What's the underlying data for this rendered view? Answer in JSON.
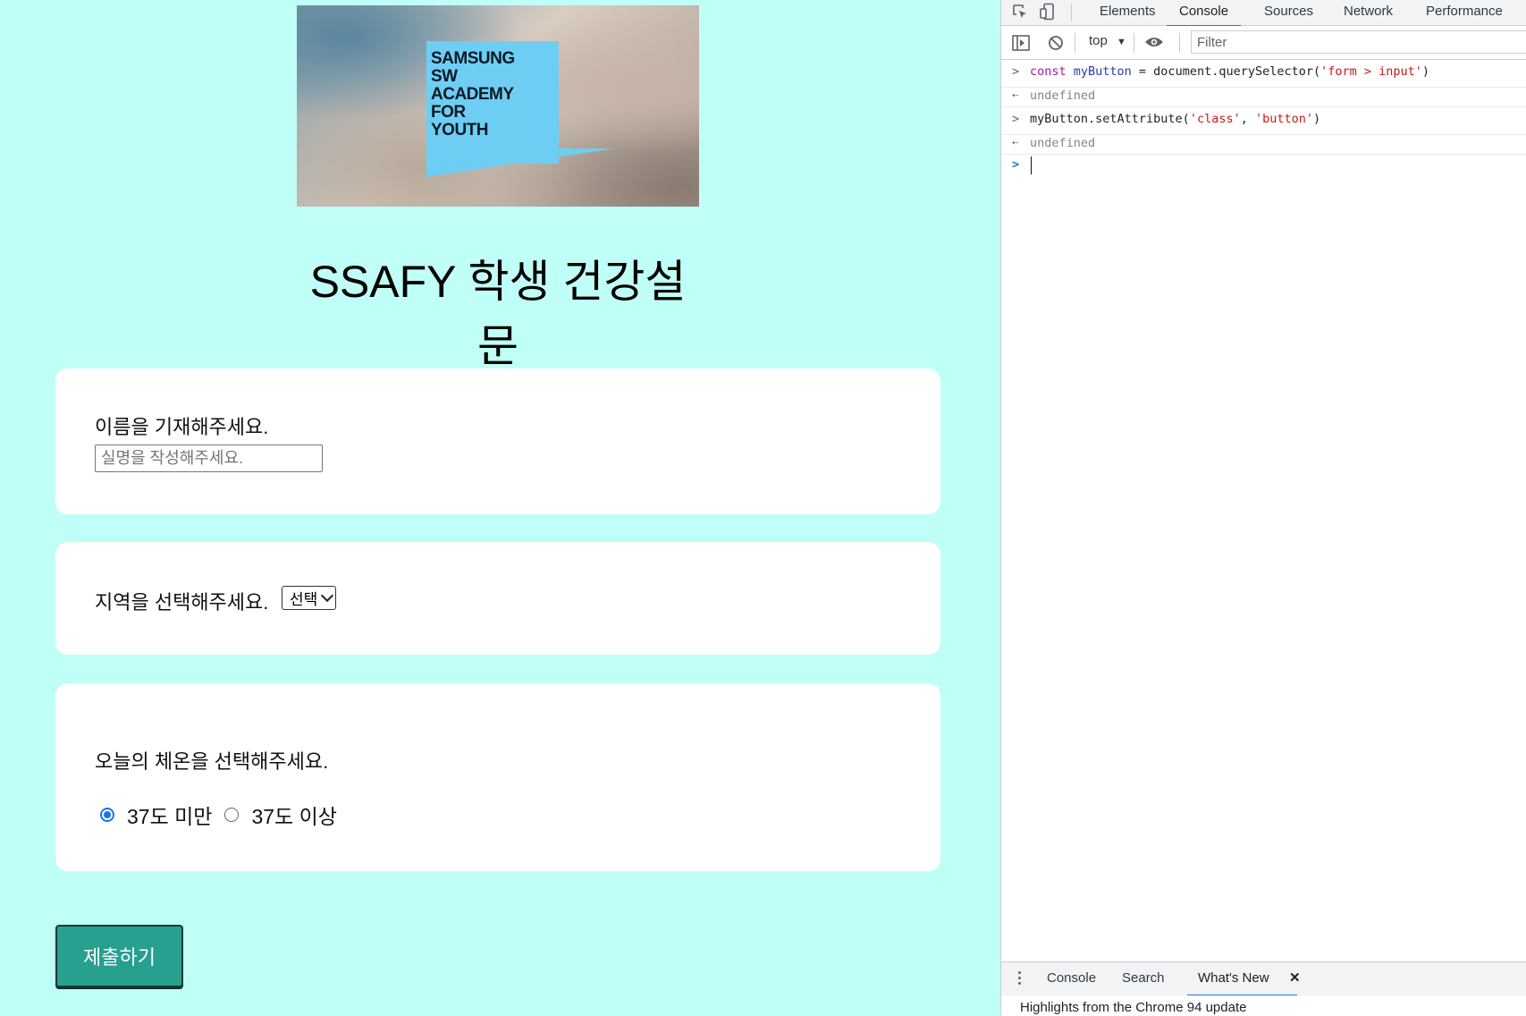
{
  "banner": {
    "logo_lines": [
      "SAMSUNG",
      "SW",
      "ACADEMY",
      "FOR",
      "YOUTH"
    ]
  },
  "page": {
    "title": "SSAFY 학생 건강설문"
  },
  "form": {
    "name_question": "이름을 기재해주세요.",
    "name_placeholder": "실명을 작성해주세요.",
    "region_question": "지역을 선택해주세요.",
    "region_selected": "선택",
    "temp_question": "오늘의 체온을 선택해주세요.",
    "temp_options": [
      "37도 미만",
      "37도 이상"
    ],
    "submit_label": "제출하기"
  },
  "devtools": {
    "tabs": [
      "Elements",
      "Console",
      "Sources",
      "Network",
      "Performance"
    ],
    "active_tab": "Console",
    "context": "top",
    "filter_placeholder": "Filter",
    "console_lines": [
      {
        "kind": "input",
        "parts": [
          "const",
          " myButton",
          " = document.querySelector(",
          "'form > input'",
          ")"
        ]
      },
      {
        "kind": "output",
        "text": "undefined"
      },
      {
        "kind": "input",
        "parts": [
          "myButton.setAttribute(",
          "'class'",
          ", ",
          "'button'",
          ")"
        ]
      },
      {
        "kind": "output",
        "text": "undefined"
      }
    ],
    "drawer_tabs": [
      "Console",
      "Search",
      "What's New"
    ],
    "drawer_active": "What's New",
    "drawer_text": "Highlights from the Chrome 94 update"
  },
  "colors": {
    "page_bg": "#c0fff7",
    "submit_bg": "#27a090",
    "accent": "#1a73e8"
  }
}
